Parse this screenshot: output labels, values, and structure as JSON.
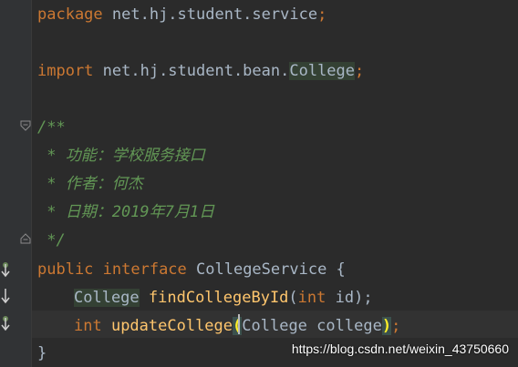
{
  "code": {
    "line1": {
      "keyword": "package",
      "name": " net.hj.student.service",
      "punct": ";"
    },
    "line3": {
      "keyword": "import",
      "path": " net.hj.student.bean.",
      "cls": "College",
      "punct": ";"
    },
    "line5": "/**",
    "line6": " * 功能：学校服务接口",
    "line7": " * 作者：何杰",
    "line8": " * 日期：2019年7月1日",
    "line9": " */",
    "line10": {
      "kw1": "public",
      "kw2": " interface",
      "name": " CollegeService {"
    },
    "line11": {
      "type": "College",
      "method": " findCollegeById",
      "open": "(",
      "ptype": "int",
      "pname": " id",
      "close": ");"
    },
    "line12": {
      "ret": "int",
      "method": " updateCollege",
      "open": "(",
      "ptype": "College",
      "pname": " college",
      "close": ")",
      "semi": ";"
    },
    "line13": "}"
  },
  "gutter": {
    "fold_icon": "fold-icon",
    "implement_icon": "implemented-down-arrow-icon"
  },
  "watermark": "https://blog.csdn.net/weixin_43750660",
  "colors": {
    "background": "#2b2b2b",
    "keyword": "#cc7832",
    "comment": "#629755",
    "method": "#ffc66d",
    "plain": "#a9b7c6"
  }
}
